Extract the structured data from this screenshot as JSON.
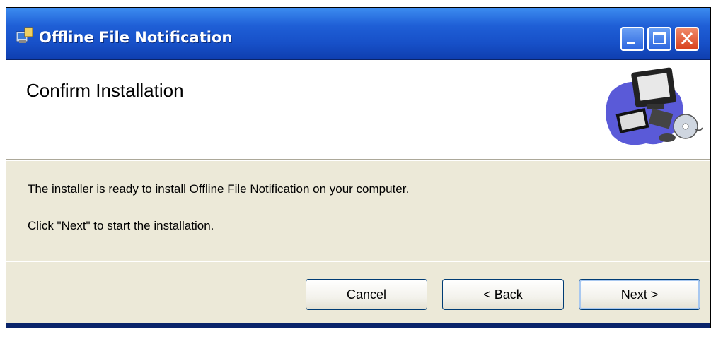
{
  "window": {
    "title": "Offline File Notification",
    "icon": "installer-icon"
  },
  "titlebar_buttons": {
    "minimize": "minimize-icon",
    "maximize": "maximize-icon",
    "close": "close-icon"
  },
  "header": {
    "title": "Confirm Installation",
    "art": "computer-illustration"
  },
  "body": {
    "line1": "The installer is ready to install Offline File Notification on your computer.",
    "line2": "Click \"Next\" to start the installation."
  },
  "buttons": {
    "cancel": "Cancel",
    "back": "< Back",
    "next": "Next >"
  },
  "colors": {
    "titlebar": "#1f5fd6",
    "panel": "#ece9d8",
    "close": "#d8401c"
  }
}
